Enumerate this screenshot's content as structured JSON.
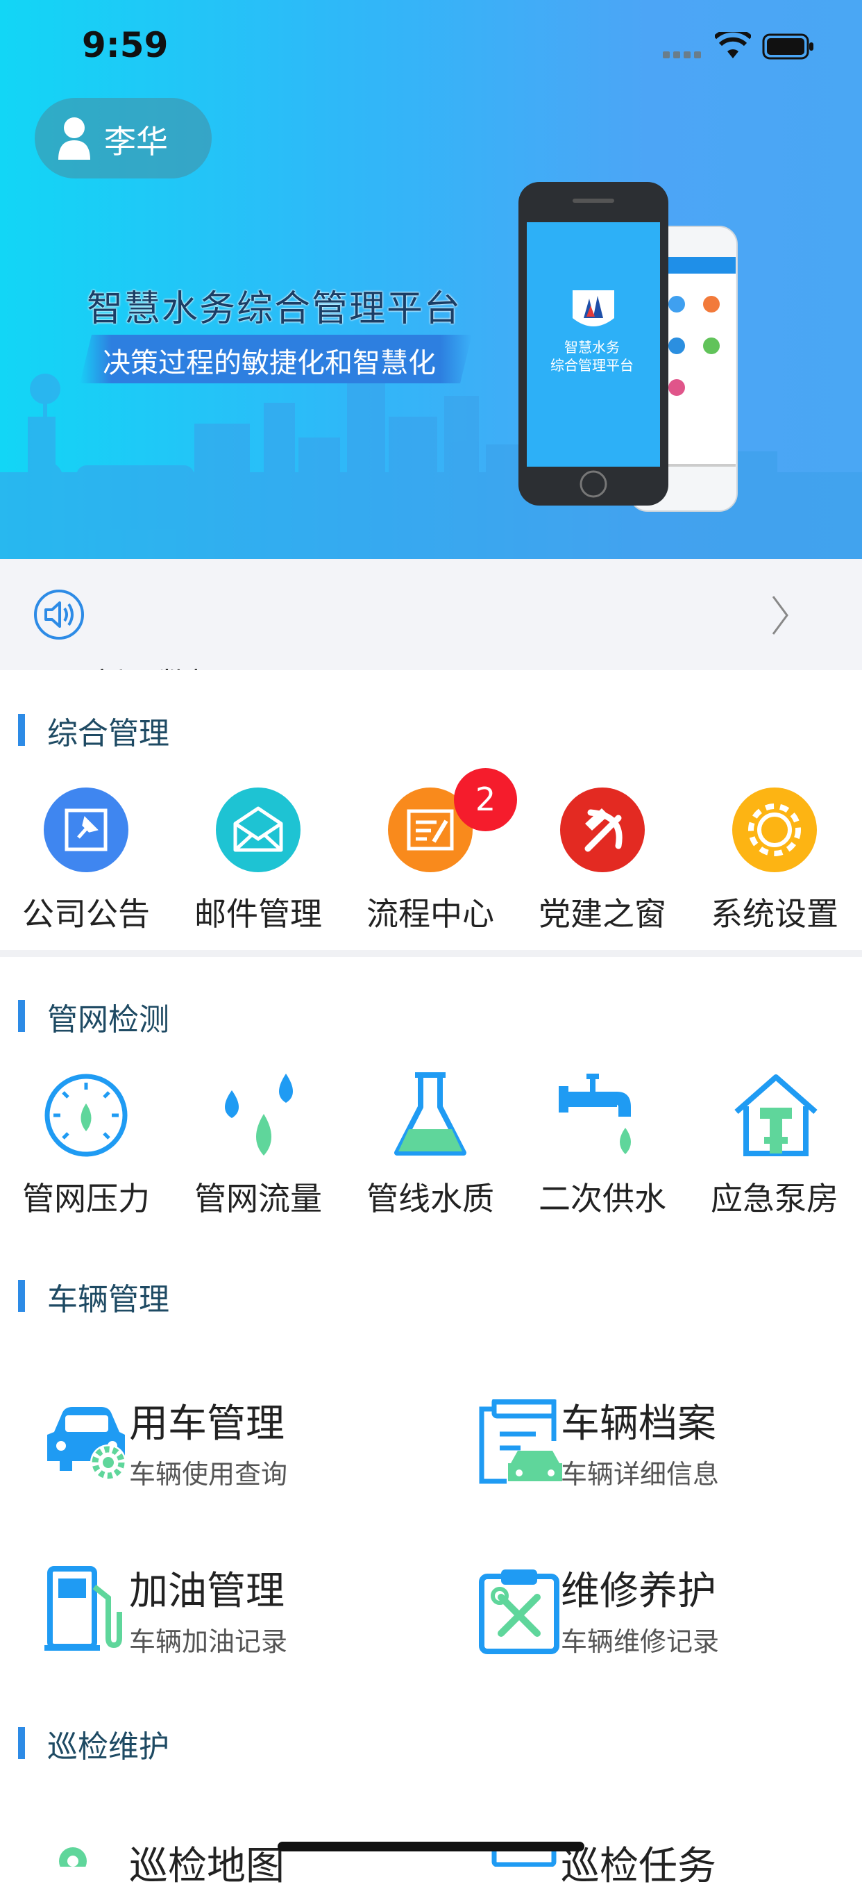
{
  "status_bar": {
    "time": "9:59"
  },
  "user": {
    "name": "李华"
  },
  "banner": {
    "title": "智慧水务综合管理平台",
    "slogan": "决策过程的敏捷化和智慧化",
    "phone_screen_text": "智慧水务\n综合管理平台"
  },
  "notice": {
    "text": "新工数据"
  },
  "sections": {
    "general": {
      "title": "综合管理",
      "items": [
        {
          "label": "公司公告",
          "icon": "pin-icon",
          "color": "#3f86f0"
        },
        {
          "label": "邮件管理",
          "icon": "mail-icon",
          "color": "#1ec3d3"
        },
        {
          "label": "流程中心",
          "icon": "edit-doc-icon",
          "color": "#f98a1c",
          "badge": "2"
        },
        {
          "label": "党建之窗",
          "icon": "hammer-sickle-icon",
          "color": "#e32a22"
        },
        {
          "label": "系统设置",
          "icon": "gear-icon",
          "color": "#fdb413"
        }
      ]
    },
    "pipe": {
      "title": "管网检测",
      "items": [
        {
          "label": "管网压力",
          "icon": "gauge-icon"
        },
        {
          "label": "管网流量",
          "icon": "droplets-icon"
        },
        {
          "label": "管线水质",
          "icon": "flask-icon"
        },
        {
          "label": "二次供水",
          "icon": "faucet-icon"
        },
        {
          "label": "应急泵房",
          "icon": "pump-house-icon"
        }
      ]
    },
    "vehicle": {
      "title": "车辆管理",
      "items": [
        {
          "title": "用车管理",
          "sub": "车辆使用查询",
          "icon": "car-gear-icon"
        },
        {
          "title": "车辆档案",
          "sub": "车辆详细信息",
          "icon": "car-file-icon"
        },
        {
          "title": "加油管理",
          "sub": "车辆加油记录",
          "icon": "fuel-pump-icon"
        },
        {
          "title": "维修养护",
          "sub": "车辆维修记录",
          "icon": "repair-tools-icon"
        }
      ]
    },
    "patrol": {
      "title": "巡检维护",
      "items": [
        {
          "title": "巡检地图",
          "icon": "map-pin-icon"
        },
        {
          "title": "巡检任务",
          "icon": "task-icon"
        }
      ]
    }
  },
  "colors": {
    "primary_blue": "#1f9bf3",
    "green": "#5fd69b",
    "section_bar": "#2d8be6",
    "badge": "#f51c2c"
  }
}
